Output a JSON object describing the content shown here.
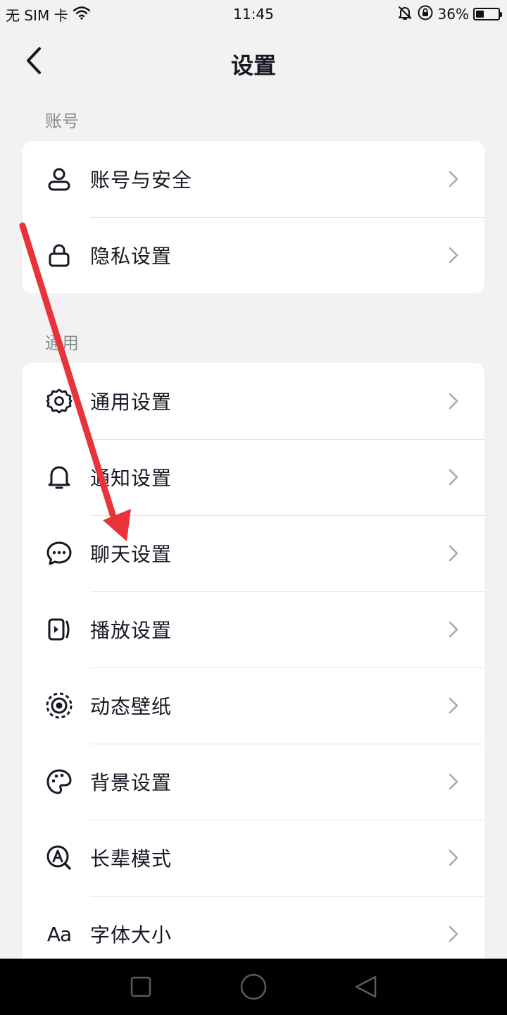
{
  "status_bar": {
    "carrier": "无 SIM 卡",
    "time": "11:45",
    "battery": "36%",
    "battery_level": 0.36,
    "icons": [
      "wifi-icon",
      "mute-bell-icon",
      "rotation-lock-icon",
      "battery-icon"
    ]
  },
  "header": {
    "title": "设置",
    "back_icon": "chevron-left-icon"
  },
  "sections": [
    {
      "label": "账号",
      "items": [
        {
          "label": "账号与安全",
          "icon": "person-icon"
        },
        {
          "label": "隐私设置",
          "icon": "lock-icon"
        }
      ]
    },
    {
      "label": "通用",
      "items": [
        {
          "label": "通用设置",
          "icon": "gear-icon"
        },
        {
          "label": "通知设置",
          "icon": "bell-icon"
        },
        {
          "label": "聊天设置",
          "icon": "chat-bubble-icon"
        },
        {
          "label": "播放设置",
          "icon": "play-screen-icon"
        },
        {
          "label": "动态壁纸",
          "icon": "live-wallpaper-icon"
        },
        {
          "label": "背景设置",
          "icon": "palette-icon"
        },
        {
          "label": "长辈模式",
          "icon": "elder-mode-icon"
        },
        {
          "label": "字体大小",
          "icon": "font-size-icon",
          "icon_text": "Aa"
        }
      ]
    }
  ],
  "navigation_bar": {
    "buttons": [
      "recents-square-icon",
      "home-circle-icon",
      "back-triangle-icon"
    ]
  },
  "colors": {
    "background": "#f2f2f2",
    "card": "#ffffff",
    "text": "#161823",
    "section_label": "#8a8b91",
    "chevron": "#a8a9ad",
    "annotation_arrow": "#e8333a"
  }
}
